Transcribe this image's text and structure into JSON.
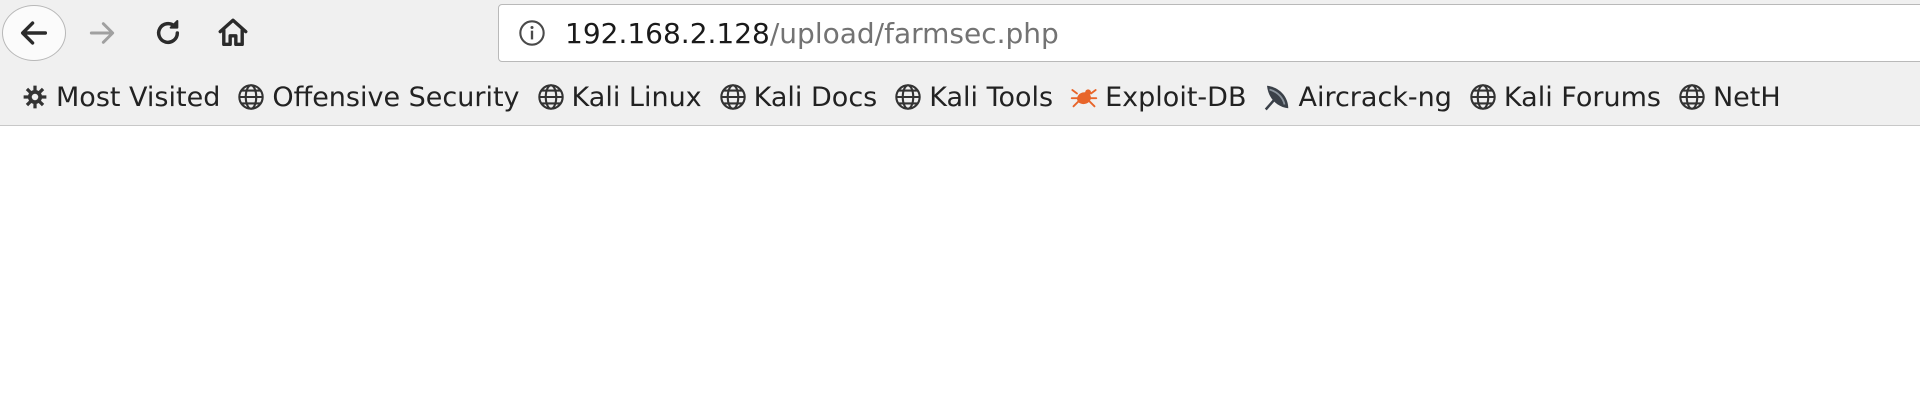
{
  "toolbar": {
    "back": "back-arrow-icon",
    "forward": "forward-arrow-icon",
    "reload": "reload-icon",
    "home": "home-icon"
  },
  "url_bar": {
    "host": "192.168.2.128",
    "path": "/upload/farmsec.php",
    "icon": "info-icon"
  },
  "bookmarks": [
    {
      "label": "Most Visited",
      "icon": "gear-icon"
    },
    {
      "label": "Offensive Security",
      "icon": "globe-icon"
    },
    {
      "label": "Kali Linux",
      "icon": "globe-icon"
    },
    {
      "label": "Kali Docs",
      "icon": "globe-icon"
    },
    {
      "label": "Kali Tools",
      "icon": "globe-icon"
    },
    {
      "label": "Exploit-DB",
      "icon": "bug-icon"
    },
    {
      "label": "Aircrack-ng",
      "icon": "satellite-dish-icon"
    },
    {
      "label": "Kali Forums",
      "icon": "globe-icon"
    },
    {
      "label": "NetH",
      "icon": "globe-icon"
    }
  ],
  "colors": {
    "chrome_bg": "#f0f0f0",
    "url_host": "#1a1a1a",
    "url_path": "#737373",
    "exploit_db": "#e8652a"
  }
}
